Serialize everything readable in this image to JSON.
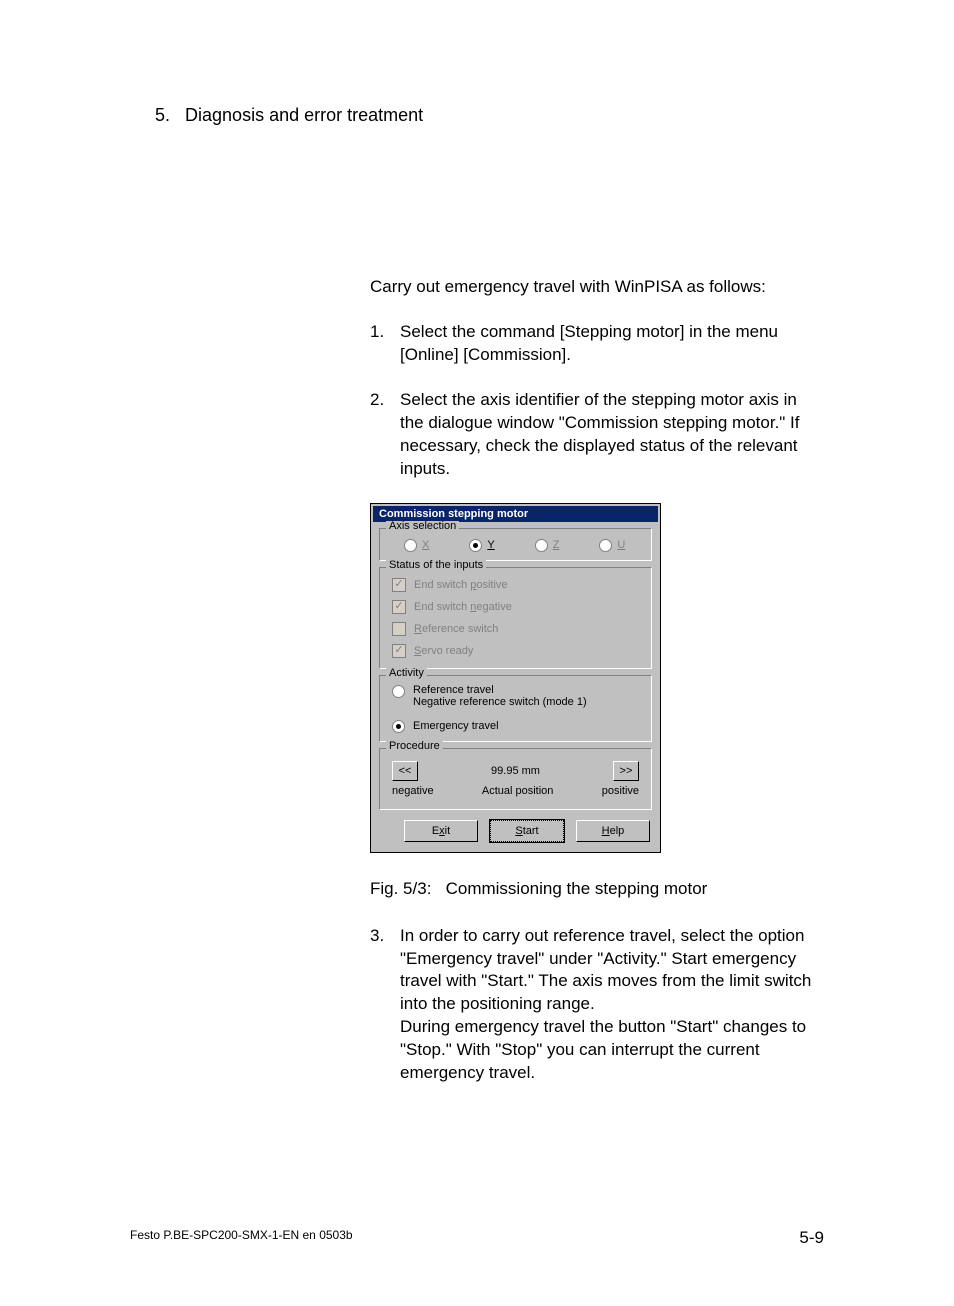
{
  "chapter": {
    "number": "5.",
    "title": "Diagnosis and error treatment"
  },
  "intro": "Carry out emergency travel with WinPISA as follows:",
  "steps": {
    "s1": {
      "n": "1.",
      "t": "Select the command [Stepping motor] in the menu [Online] [Commission]."
    },
    "s2": {
      "n": "2.",
      "t": "Select the axis identifier of the stepping motor axis in the dialogue window \"Commission stepping motor.\" If necessary, check the displayed status of the relevant inputs."
    },
    "s3": {
      "n": "3.",
      "t": "In order to carry out reference travel, select the option \"Emergency travel\" under \"Activity.\" Start emergency travel with \"Start.\" The axis moves from the limit switch into the positioning range.\nDuring emergency travel the button \"Start\" changes to \"Stop.\" With \"Stop\" you can interrupt the current emergency travel."
    }
  },
  "dialog": {
    "title": "Commission stepping motor",
    "axis_group": "Axis selection",
    "axes": {
      "x": "X",
      "y": "Y",
      "z": "Z",
      "u": "U"
    },
    "selected_axis": "Y",
    "status_group": "Status of the inputs",
    "status": {
      "end_pos": "End switch positive",
      "end_neg": "End switch negative",
      "ref": "Reference switch",
      "servo": "Servo ready"
    },
    "status_checked": {
      "end_pos": true,
      "end_neg": true,
      "ref": false,
      "servo": true
    },
    "activity_group": "Activity",
    "activity": {
      "ref_travel": "Reference travel",
      "ref_sub": "Negative reference switch (mode 1)",
      "emergency": "Emergency travel"
    },
    "selected_activity": "emergency",
    "procedure_group": "Procedure",
    "procedure": {
      "back": "<<",
      "fwd": ">>",
      "position": "99.95 mm",
      "neg_label": "negative",
      "act_label": "Actual position",
      "pos_label": "positive"
    },
    "buttons": {
      "exit": "Exit",
      "start": "Start",
      "help": "Help"
    }
  },
  "caption": {
    "label": "Fig. 5/3:",
    "text": "Commissioning the stepping motor"
  },
  "footer": {
    "doc": "Festo P.BE-SPC200-SMX-1-EN en 0503b",
    "page": "5-9"
  }
}
